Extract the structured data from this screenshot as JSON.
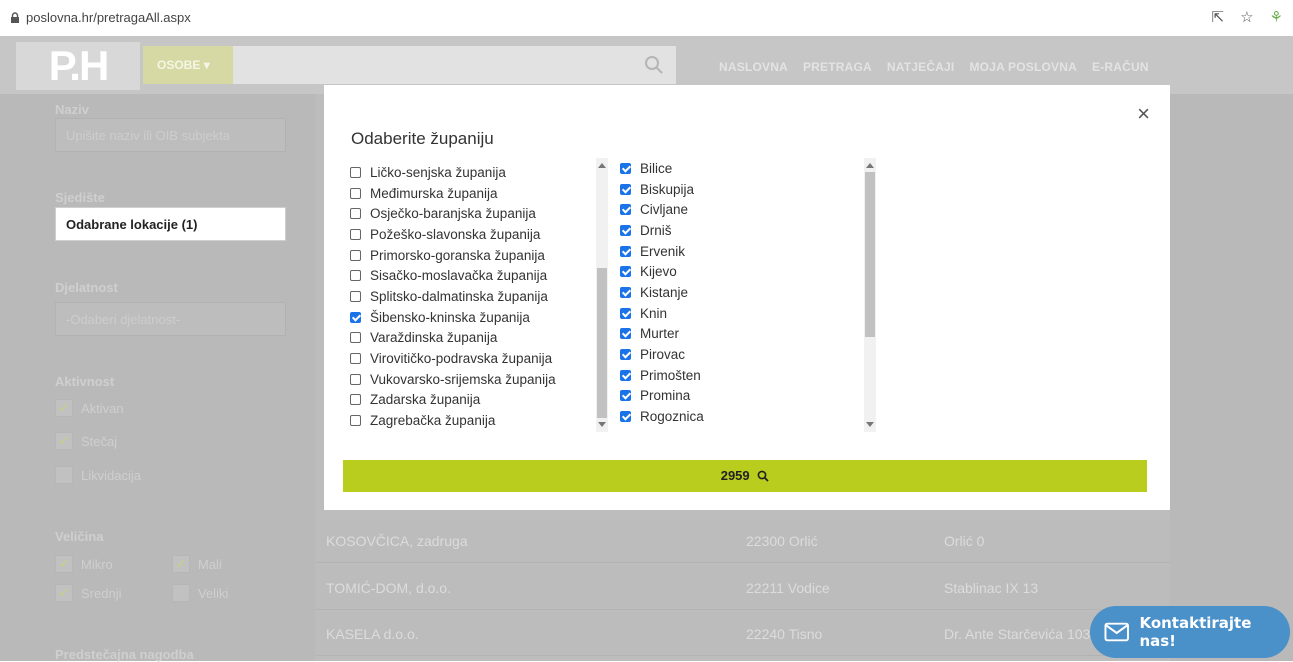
{
  "browser": {
    "url": "poslovna.hr/pretragaAll.aspx"
  },
  "header": {
    "logo": "P.H",
    "category": "OSOBE",
    "nav": [
      "NASLOVNA",
      "PRETRAGA",
      "NATJEČAJI",
      "MOJA POSLOVNA",
      "E-RAČUN"
    ]
  },
  "sidebar": {
    "naziv_label": "Naziv",
    "naziv_placeholder": "Upišite naziv ili OIB subjekta",
    "sjediste_label": "Sjedište",
    "sjediste_value": "Odabrane lokacije (1)",
    "djelatnost_label": "Djelatnost",
    "djelatnost_value": "-Odaberi djelatnost-",
    "aktivnost_label": "Aktivnost",
    "aktivnost": [
      {
        "label": "Aktivan",
        "checked": true
      },
      {
        "label": "Stečaj",
        "checked": true
      },
      {
        "label": "Likvidacija",
        "checked": false
      }
    ],
    "velicina_label": "Veličina",
    "velicina": [
      {
        "label": "Mikro",
        "checked": true
      },
      {
        "label": "Mali",
        "checked": true
      },
      {
        "label": "Srednji",
        "checked": true
      },
      {
        "label": "Veliki",
        "checked": false
      }
    ],
    "predstecajna_label": "Predstečajna nagodba"
  },
  "results": [
    {
      "name": "KOSOVČICA, zadruga",
      "city": "22300 Orlić",
      "address": "Orlić 0"
    },
    {
      "name": "TOMIĆ-DOM, d.o.o.",
      "city": "22211 Vodice",
      "address": "Stablinac IX 13"
    },
    {
      "name": "KASELA d.o.o.",
      "city": "22240 Tisno",
      "address": "Dr. Ante Starčevića 103"
    }
  ],
  "modal": {
    "title": "Odaberite županiju",
    "close": "×",
    "counties": [
      {
        "label": "Ličko-senjska županija",
        "checked": false
      },
      {
        "label": "Međimurska županija",
        "checked": false
      },
      {
        "label": "Osječko-baranjska županija",
        "checked": false
      },
      {
        "label": "Požeško-slavonska županija",
        "checked": false
      },
      {
        "label": "Primorsko-goranska županija",
        "checked": false
      },
      {
        "label": "Sisačko-moslavačka županija",
        "checked": false
      },
      {
        "label": "Splitsko-dalmatinska županija",
        "checked": false
      },
      {
        "label": "Šibensko-kninska županija",
        "checked": true
      },
      {
        "label": "Varaždinska županija",
        "checked": false
      },
      {
        "label": "Virovitičko-podravska županija",
        "checked": false
      },
      {
        "label": "Vukovarsko-srijemska županija",
        "checked": false
      },
      {
        "label": "Zadarska županija",
        "checked": false
      },
      {
        "label": "Zagrebačka županija",
        "checked": false
      }
    ],
    "municipalities": [
      {
        "label": "Bilice",
        "checked": true
      },
      {
        "label": "Biskupija",
        "checked": true
      },
      {
        "label": "Civljane",
        "checked": true
      },
      {
        "label": "Drniš",
        "checked": true
      },
      {
        "label": "Ervenik",
        "checked": true
      },
      {
        "label": "Kijevo",
        "checked": true
      },
      {
        "label": "Kistanje",
        "checked": true
      },
      {
        "label": "Knin",
        "checked": true
      },
      {
        "label": "Murter",
        "checked": true
      },
      {
        "label": "Pirovac",
        "checked": true
      },
      {
        "label": "Primošten",
        "checked": true
      },
      {
        "label": "Promina",
        "checked": true
      },
      {
        "label": "Rogoznica",
        "checked": true
      }
    ],
    "count_button": "2959"
  },
  "contact": {
    "label": "Kontaktirajte nas!"
  }
}
